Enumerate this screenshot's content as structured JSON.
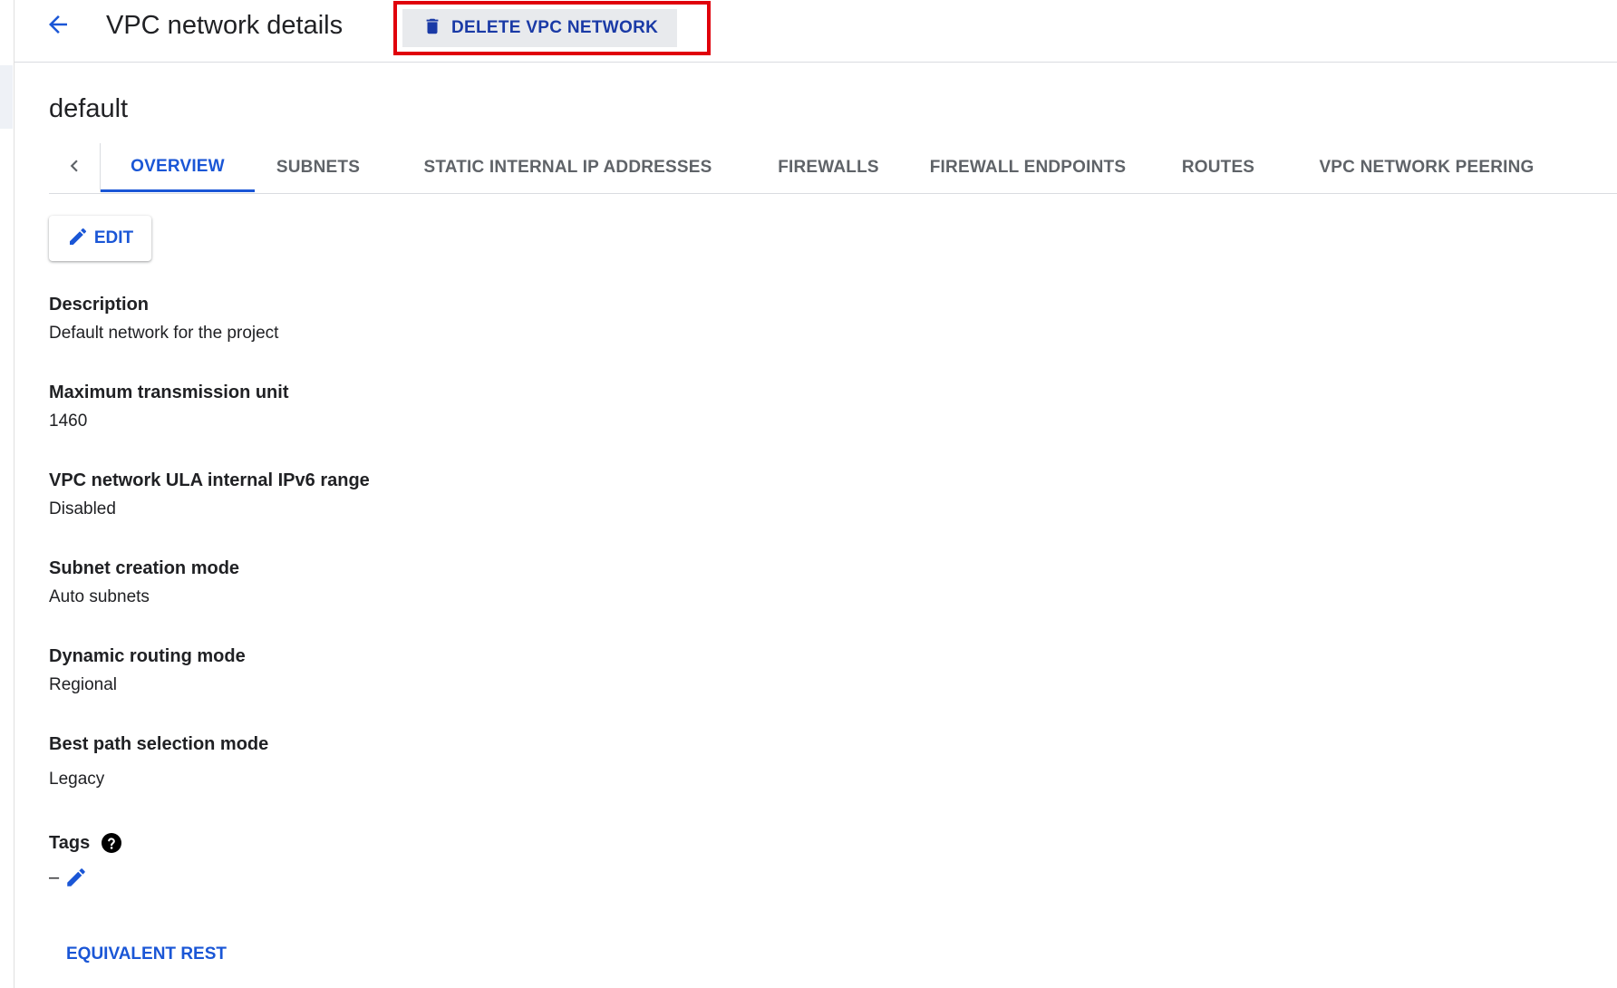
{
  "header": {
    "title": "VPC network details",
    "delete_label": "DELETE VPC NETWORK"
  },
  "network": {
    "name": "default"
  },
  "tabs": [
    {
      "label": "OVERVIEW",
      "active": true
    },
    {
      "label": "SUBNETS",
      "active": false
    },
    {
      "label": "STATIC INTERNAL IP ADDRESSES",
      "active": false
    },
    {
      "label": "FIREWALLS",
      "active": false
    },
    {
      "label": "FIREWALL ENDPOINTS",
      "active": false
    },
    {
      "label": "ROUTES",
      "active": false
    },
    {
      "label": "VPC NETWORK PEERING",
      "active": false
    }
  ],
  "actions": {
    "edit_label": "EDIT",
    "equivalent_rest_label": "EQUIVALENT REST"
  },
  "fields": [
    {
      "label": "Description",
      "value": "Default network for the project"
    },
    {
      "label": "Maximum transmission unit",
      "value": "1460"
    },
    {
      "label": "VPC network ULA internal IPv6 range",
      "value": "Disabled"
    },
    {
      "label": "Subnet creation mode",
      "value": "Auto subnets"
    },
    {
      "label": "Dynamic routing mode",
      "value": "Regional"
    },
    {
      "label": "Best path selection mode",
      "value": "Legacy"
    }
  ],
  "tags": {
    "label": "Tags",
    "value": "–"
  },
  "icons": {
    "back": "arrow-back-icon",
    "delete": "trash-icon",
    "scroll_left": "chevron-left-icon",
    "edit": "pencil-icon",
    "help": "help-circle-icon"
  },
  "colors": {
    "accent": "#1a56d6",
    "delete_text": "#1a3aa6",
    "highlight_box": "#e0000b"
  }
}
